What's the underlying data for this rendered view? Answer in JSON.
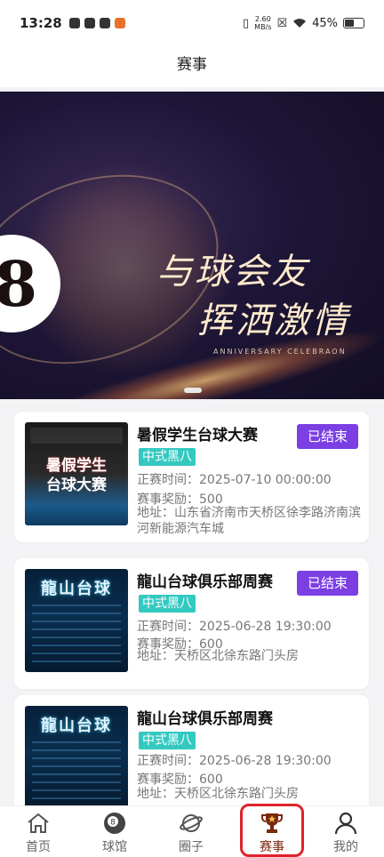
{
  "status_bar": {
    "time": "13:28",
    "speed_value": "2.60",
    "speed_unit": "MB/s",
    "battery": "45%",
    "battery_level": 0.45
  },
  "navbar": {
    "title": "赛事"
  },
  "banner": {
    "line1": "与球会友",
    "line2": "挥洒激情",
    "subtitle": "ANNIVERSARY CELEBRAON",
    "ball_number": "8"
  },
  "events": [
    {
      "title": "暑假学生台球大赛",
      "status": "已结束",
      "tag": "中式黑八",
      "time": "正赛时间：2025-07-10 00:00:00",
      "prize": "赛事奖励：500",
      "address": "地址：山东省济南市天桥区徐李路济南滨河新能源汽车城",
      "poster_text_1": "暑假学生",
      "poster_text_2": "台球大赛"
    },
    {
      "title": "龍山台球俱乐部周赛",
      "status": "已结束",
      "tag": "中式黑八",
      "time": "正赛时间：2025-06-28 19:30:00",
      "prize": "赛事奖励：600",
      "address": "地址：天桥区北徐东路门头房",
      "poster_text_1": "龍山台球"
    },
    {
      "title": "龍山台球俱乐部周赛",
      "tag": "中式黑八",
      "time": "正赛时间：2025-06-28 19:30:00",
      "prize": "赛事奖励：600",
      "address": "地址：天桥区北徐东路门头房",
      "poster_text_1": "龍山台球"
    }
  ],
  "tabbar": {
    "items": [
      {
        "label": "首页",
        "icon": "home-icon"
      },
      {
        "label": "球馆",
        "icon": "billiard-ball-icon"
      },
      {
        "label": "圈子",
        "icon": "planet-icon"
      },
      {
        "label": "赛事",
        "icon": "trophy-icon",
        "active": true
      },
      {
        "label": "我的",
        "icon": "user-icon"
      }
    ],
    "active_color": "#7a2a10"
  },
  "colors": {
    "status_button": "#7c3fe4",
    "tag": "#34c9c0",
    "highlight_outline": "#e0232a"
  }
}
